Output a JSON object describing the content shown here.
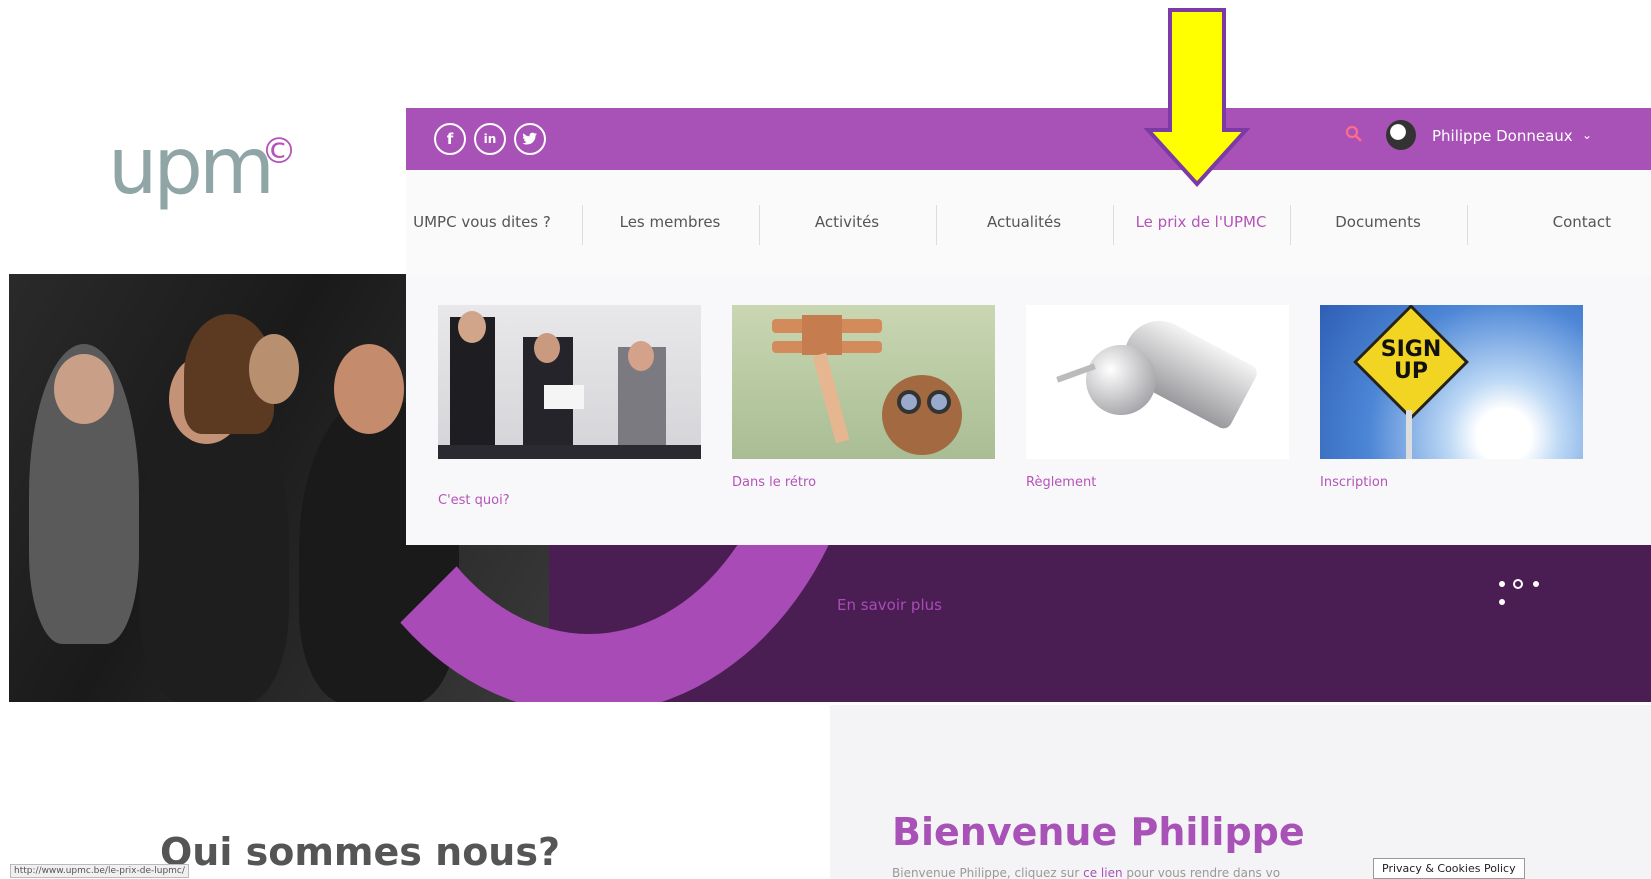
{
  "logo": {
    "text": "upm",
    "mark": "©"
  },
  "topbar": {
    "social": [
      {
        "icon": "facebook-icon",
        "glyph": "f"
      },
      {
        "icon": "linkedin-icon",
        "glyph": "in"
      },
      {
        "icon": "twitter-icon",
        "glyph": "t"
      }
    ],
    "user_name": "Philippe Donneaux",
    "user_menu_chevron": "⌄"
  },
  "nav": {
    "items": [
      {
        "label": "UMPC vous dites ?"
      },
      {
        "label": "Les membres"
      },
      {
        "label": "Activités"
      },
      {
        "label": "Actualités"
      },
      {
        "label": "Le prix de l'UPMC"
      },
      {
        "label": "Documents"
      },
      {
        "label": "Contact"
      }
    ],
    "active_index": 4
  },
  "dropdown": {
    "cards": [
      {
        "label": "C'est quoi?",
        "image": "award-ceremony-photo"
      },
      {
        "label": "Dans le rétro",
        "image": "toy-plane-photo"
      },
      {
        "label": "Règlement",
        "image": "whistle-photo"
      },
      {
        "label": "Inscription",
        "image": "sign-up-sign-photo",
        "sign_text_1": "SIGN",
        "sign_text_2": "UP"
      }
    ]
  },
  "hero": {
    "cta": "En savoir plus"
  },
  "main": {
    "left_title": "Qui sommes nous?",
    "right_title": "Bienvenue Philippe",
    "right_text_before": "Bienvenue Philippe, cliquez sur ",
    "right_text_link": "ce lien",
    "right_text_after": " pour vous rendre dans vo"
  },
  "status_bar_url": "http://www.upmc.be/le-prix-de-lupmc/",
  "cookie_button": "Privacy & Cookies Policy",
  "colors": {
    "brand_purple": "#a852b7",
    "dark_purple": "#4a1e52",
    "logo_gray": "#8fa5a6",
    "arrow_yellow": "#ffff00"
  }
}
